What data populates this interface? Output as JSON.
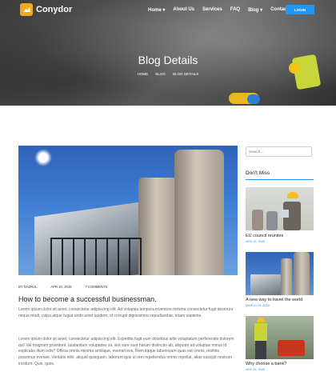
{
  "nav": {
    "logo": "Conydor",
    "menu": [
      "Home ▾",
      "About Us",
      "Services",
      "FAQ",
      "Blog ▾",
      "Contact"
    ],
    "login_label": "LOGIN"
  },
  "hero": {
    "title": "Blog Details",
    "breadcrumbs": [
      "HOME",
      "BLOG",
      "BLOG DETAILS"
    ]
  },
  "post": {
    "meta": [
      "BY NAZRUL",
      "APR 10, 2019",
      "7 COMMENTS"
    ],
    "title": "How to become a successful businessman.",
    "paragraph1": "Lorem ipsum dolor sit amet, consectetur adipisicing elit. Ad voluptas tempora inventore minima consectetur fugit deserunt neque modi, culpa atque fugiat unde amet quidem, et corrupti dignissimos repudiandae, totam sapiente.",
    "paragraph2": "Lorem ipsum dolor sit amet, consectetur adipisicing elit. Expedita fugit eum doloribus sitte voluptatum perferendis dolorem qui! Vel magnam provident, laudantium voluptates sit, sint sure sunt harum distinctio ab, aliquam ad voluptas minus id explicabo illum odio? Officia omnis minima similique, eveniet eos. Rem itaque laboriosam quas est omnis, mollitia possimus eveniet. Veritatis nihil, aliquid quisquam, laborum quis ut rem repellendus omnis repellat, alias suscipit nostrum incidunt. Quis, quos."
  },
  "sidebar": {
    "search_placeholder": "Search...",
    "heading": "Don't Miss",
    "items": [
      {
        "title": "EU council reunites",
        "date": "NOV 25, 2020"
      },
      {
        "title": "A new way to travel the world",
        "date": "MARCH 25, 2020"
      },
      {
        "title": "Why choose a bank?",
        "date": "NOV 25, 2020"
      }
    ]
  },
  "colors": {
    "accent": "#2196f3",
    "logo": "#f2a91e"
  }
}
